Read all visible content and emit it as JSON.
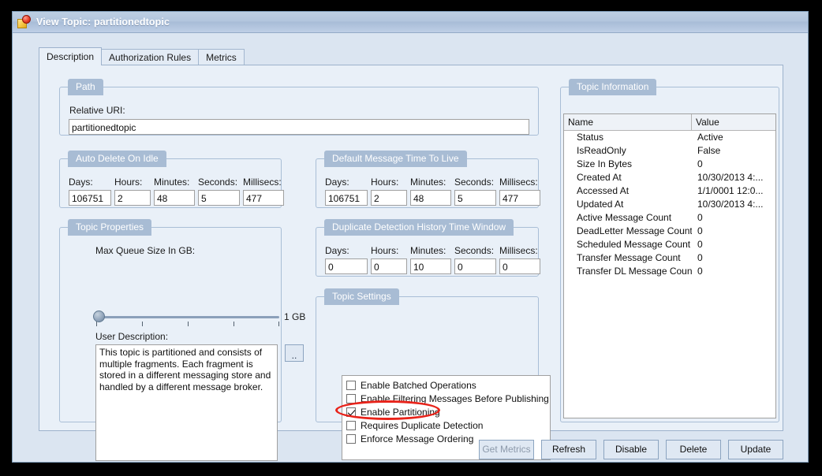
{
  "window": {
    "title": "View Topic: partitionedtopic",
    "icon": "topic-icon"
  },
  "tabs": [
    {
      "label": "Description",
      "active": true
    },
    {
      "label": "Authorization Rules",
      "active": false
    },
    {
      "label": "Metrics",
      "active": false
    }
  ],
  "path_group": {
    "legend": "Path",
    "relative_uri_label": "Relative URI:",
    "relative_uri_value": "partitionedtopic"
  },
  "auto_delete": {
    "legend": "Auto Delete On Idle",
    "fields": [
      {
        "label": "Days:",
        "value": "106751"
      },
      {
        "label": "Hours:",
        "value": "2"
      },
      {
        "label": "Minutes:",
        "value": "48"
      },
      {
        "label": "Seconds:",
        "value": "5"
      },
      {
        "label": "Millisecs:",
        "value": "477"
      }
    ]
  },
  "default_ttl": {
    "legend": "Default Message Time To Live",
    "fields": [
      {
        "label": "Days:",
        "value": "106751"
      },
      {
        "label": "Hours:",
        "value": "2"
      },
      {
        "label": "Minutes:",
        "value": "48"
      },
      {
        "label": "Seconds:",
        "value": "5"
      },
      {
        "label": "Millisecs:",
        "value": "477"
      }
    ]
  },
  "dup_detection": {
    "legend": "Duplicate Detection History Time Window",
    "fields": [
      {
        "label": "Days:",
        "value": "0"
      },
      {
        "label": "Hours:",
        "value": "0"
      },
      {
        "label": "Minutes:",
        "value": "10"
      },
      {
        "label": "Seconds:",
        "value": "0"
      },
      {
        "label": "Millisecs:",
        "value": "0"
      }
    ]
  },
  "topic_properties": {
    "legend": "Topic Properties",
    "max_queue_label": "Max Queue Size In GB:",
    "slider_max_label": "1 GB",
    "slider_value": 0,
    "user_description_label": "User Description:",
    "user_description_value": "This topic is partitioned and consists of multiple fragments. Each fragment is stored in a different messaging store and handled by a different message broker.",
    "ellipsis_button_label": ".."
  },
  "topic_settings": {
    "legend": "Topic Settings",
    "items": [
      {
        "label": "Enable Batched Operations",
        "checked": false
      },
      {
        "label": "Enable Filtering Messages Before Publishing",
        "checked": false
      },
      {
        "label": "Enable Partitioning",
        "checked": true
      },
      {
        "label": "Requires Duplicate Detection",
        "checked": false
      },
      {
        "label": "Enforce Message Ordering",
        "checked": false
      }
    ],
    "highlight_color": "#e8231a",
    "highlighted_item": "Enable Partitioning"
  },
  "topic_information": {
    "legend": "Topic Information",
    "columns": [
      "Name",
      "Value"
    ],
    "rows": [
      {
        "name": "Status",
        "value": "Active"
      },
      {
        "name": "IsReadOnly",
        "value": "False"
      },
      {
        "name": "Size In Bytes",
        "value": "0"
      },
      {
        "name": "Created At",
        "value": "10/30/2013 4:..."
      },
      {
        "name": "Accessed At",
        "value": "1/1/0001 12:0..."
      },
      {
        "name": "Updated At",
        "value": "10/30/2013 4:..."
      },
      {
        "name": "Active Message Count",
        "value": "0"
      },
      {
        "name": "DeadLetter Message Count",
        "value": "0"
      },
      {
        "name": "Scheduled Message Count",
        "value": "0"
      },
      {
        "name": "Transfer Message Count",
        "value": "0"
      },
      {
        "name": "Transfer DL Message Count",
        "value": "0"
      }
    ]
  },
  "footer_buttons": [
    {
      "label": "Get Metrics",
      "disabled": true
    },
    {
      "label": "Refresh",
      "disabled": false
    },
    {
      "label": "Disable",
      "disabled": false
    },
    {
      "label": "Delete",
      "disabled": false
    },
    {
      "label": "Update",
      "disabled": false
    }
  ]
}
